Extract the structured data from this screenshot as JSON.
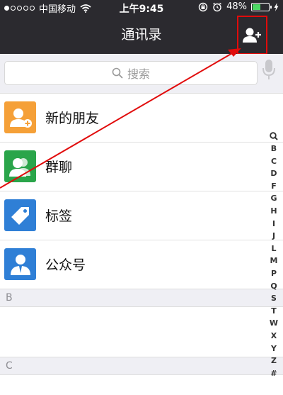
{
  "status_bar": {
    "carrier": "中国移动",
    "time": "上午9:45",
    "battery": "48%",
    "battery_level": 0.48,
    "signal_icons": [
      "signal-dots-icon",
      "wifi-icon"
    ],
    "right_icons": [
      "rotation-lock-icon",
      "alarm-icon",
      "battery-icon",
      "charging-icon"
    ]
  },
  "nav": {
    "title": "通讯录",
    "add_icon": "add-contact-icon"
  },
  "search": {
    "placeholder": "搜索",
    "icon": "search-icon",
    "voice_icon": "microphone-icon"
  },
  "list": [
    {
      "label": "新的朋友",
      "icon": "new-friend-icon",
      "color": "#f5a038"
    },
    {
      "label": "群聊",
      "icon": "group-chat-icon",
      "color": "#2aa54a"
    },
    {
      "label": "标签",
      "icon": "tag-icon",
      "color": "#2f7fd6"
    },
    {
      "label": "公众号",
      "icon": "official-account-icon",
      "color": "#2f7fd6"
    }
  ],
  "sections": [
    "B",
    "C"
  ],
  "index_bar": [
    "B",
    "C",
    "D",
    "F",
    "G",
    "H",
    "I",
    "J",
    "L",
    "M",
    "P",
    "Q",
    "S",
    "T",
    "W",
    "X",
    "Y",
    "Z",
    "#"
  ],
  "colors": {
    "navbar": "#2b2a2f",
    "annotation": "#e10b0b"
  }
}
